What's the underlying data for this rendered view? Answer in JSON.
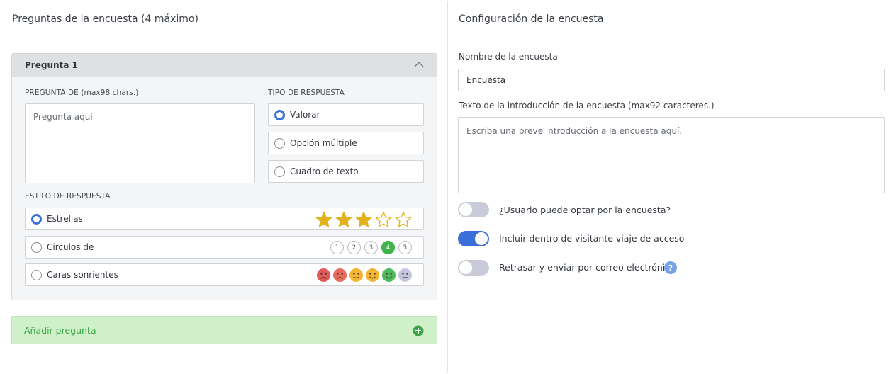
{
  "left_panel": {
    "title": "Preguntas de la encuesta (4 máximo)",
    "question": {
      "header": "Pregunta 1",
      "question_label": "PREGUNTA DE (max98 chars.)",
      "question_placeholder": "Pregunta aquí",
      "response_type_label": "TIPO DE RESPUESTA",
      "response_types": [
        {
          "label": "Valorar",
          "selected": true
        },
        {
          "label": "Opción múltiple",
          "selected": false
        },
        {
          "label": "Cuadro de texto",
          "selected": false
        }
      ],
      "response_style_label": "ESTILO DE RESPUESTA",
      "response_styles": [
        {
          "label": "Estrellas",
          "selected": true
        },
        {
          "label": "Círculos de",
          "selected": false
        },
        {
          "label": "Caras sonrientes",
          "selected": false
        }
      ],
      "stars_filled": 3,
      "stars_total": 5,
      "circle_numbers": [
        "1",
        "2",
        "3",
        "4",
        "5"
      ],
      "circle_selected": "4",
      "face_colors": [
        "#e05a5a",
        "#e86a5a",
        "#f2b630",
        "#f2b630",
        "#4cbb5a",
        "#c3c6dc"
      ]
    },
    "add_question_label": "Añadir pregunta"
  },
  "right_panel": {
    "title": "Configuración de la encuesta",
    "name_label": "Nombre de la encuesta",
    "name_value": "Encuesta",
    "intro_label": "Texto de la introducción de la encuesta (max92 caracteres.)",
    "intro_placeholder": "Escriba una breve introducción a la encuesta aquí.",
    "toggles": [
      {
        "label": "¿Usuario puede optar por la encuesta?",
        "on": false
      },
      {
        "label": "Incluir dentro de visitante viaje de acceso",
        "on": true
      },
      {
        "label": "Retrasar y enviar por correo electrónico",
        "on": false
      }
    ],
    "help_glyph": "?"
  },
  "colors": {
    "accent_blue": "#3a6fd8",
    "green": "#3db54a",
    "star_gold": "#e2b21d"
  }
}
